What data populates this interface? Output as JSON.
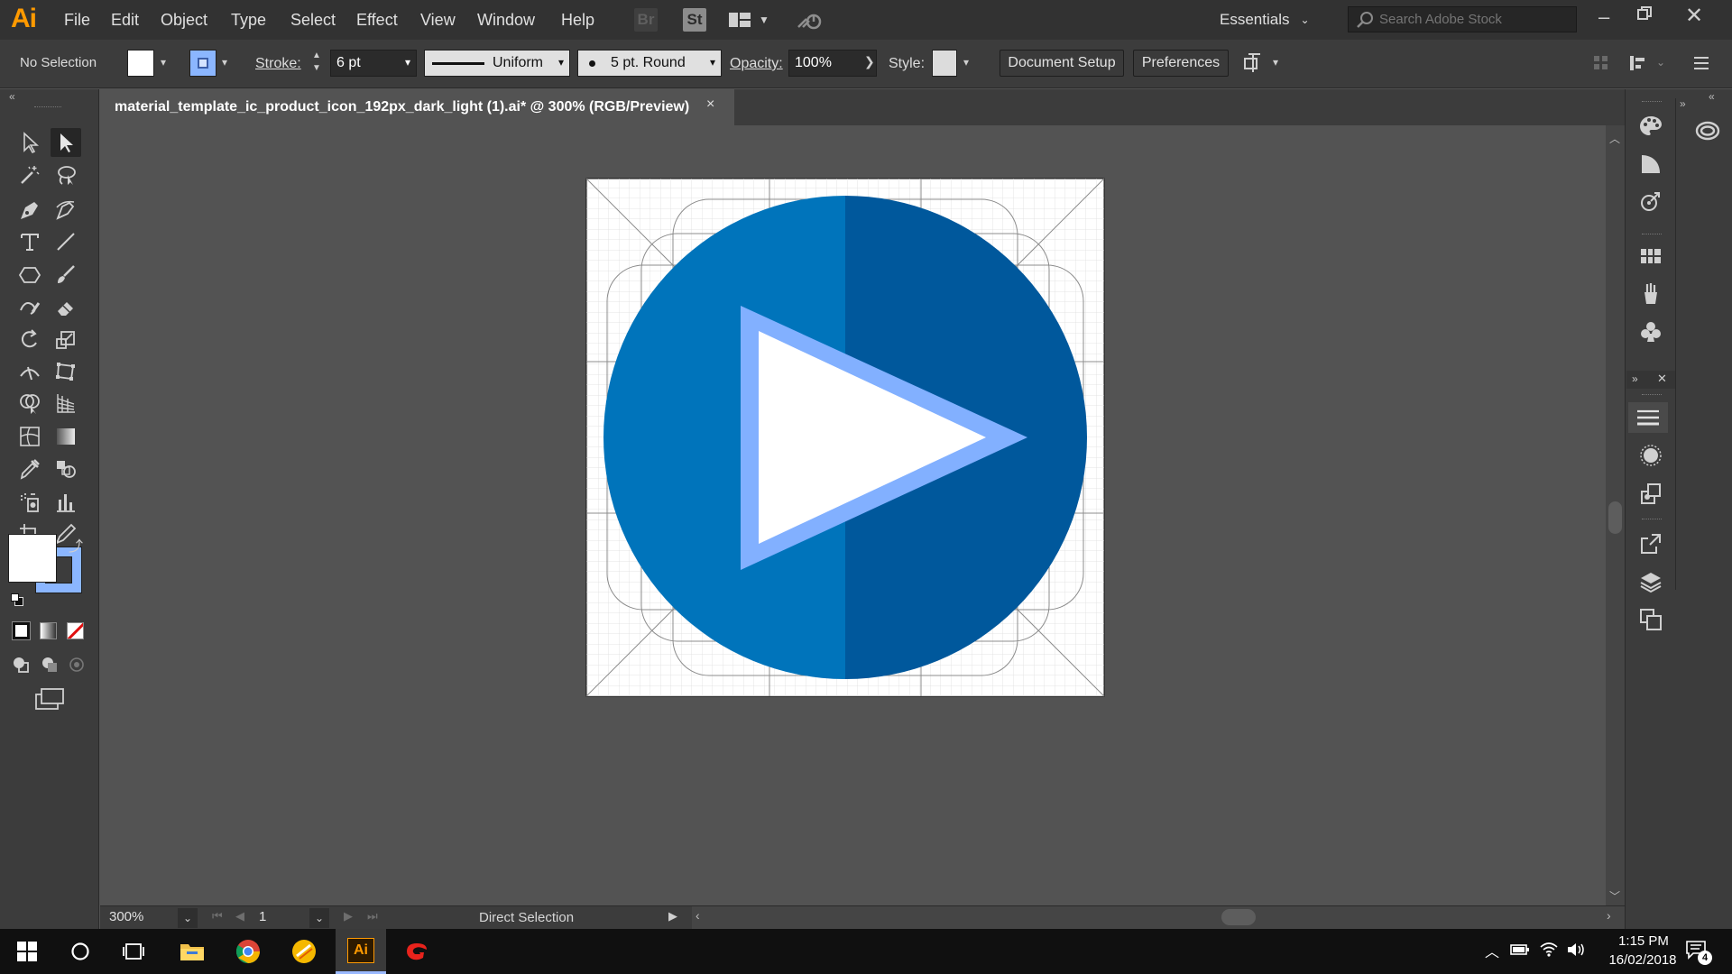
{
  "app": {
    "logo": "Ai",
    "menu": [
      "File",
      "Edit",
      "Object",
      "Type",
      "Select",
      "Effect",
      "View",
      "Window",
      "Help"
    ],
    "bridge_label": "Br",
    "stock_label": "St",
    "workspace": "Essentials",
    "search_placeholder": "Search Adobe Stock"
  },
  "control_bar": {
    "selection": "No Selection",
    "stroke_label": "Stroke:",
    "stroke_value": "6 pt",
    "stroke_profile": "Uniform",
    "brush": "5 pt. Round",
    "opacity_label": "Opacity:",
    "opacity_value": "100%",
    "style_label": "Style:",
    "document_setup": "Document Setup",
    "preferences": "Preferences"
  },
  "document": {
    "tab_title": "material_template_ic_product_icon_192px_dark_light (1).ai* @ 300% (RGB/Preview)",
    "close": "×"
  },
  "artwork": {
    "circle_left_color": "#0074bb",
    "circle_right_color": "#00589c",
    "triangle_stroke_color": "#82b0ff",
    "triangle_fill_color": "#ffffff"
  },
  "status_bar": {
    "zoom": "300%",
    "artboard": "1",
    "tool_name": "Direct Selection"
  },
  "taskbar": {
    "ai_label": "Ai",
    "time": "1:15 PM",
    "date": "16/02/2018",
    "notifications": "4"
  }
}
